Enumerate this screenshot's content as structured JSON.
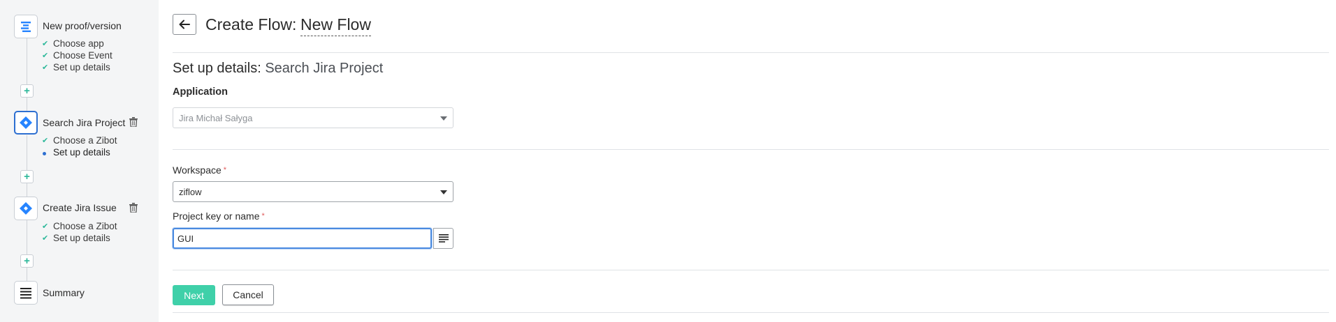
{
  "sidebar": {
    "steps": [
      {
        "title": "New proof/version",
        "icon": "trigger-lines-icon",
        "substeps": [
          {
            "label": "Choose app",
            "status": "done"
          },
          {
            "label": "Choose Event",
            "status": "done"
          },
          {
            "label": "Set up details",
            "status": "done"
          }
        ]
      },
      {
        "title": "Search Jira Project",
        "icon": "jira-icon",
        "active": true,
        "substeps": [
          {
            "label": "Choose a Zibot",
            "status": "done"
          },
          {
            "label": "Set up details",
            "status": "current"
          }
        ]
      },
      {
        "title": "Create Jira Issue",
        "icon": "jira-icon",
        "substeps": [
          {
            "label": "Choose a Zibot",
            "status": "done"
          },
          {
            "label": "Set up details",
            "status": "done"
          }
        ]
      },
      {
        "title": "Summary",
        "icon": "summary-lines-icon",
        "substeps": []
      }
    ],
    "add_step_symbol": "+"
  },
  "header": {
    "title_prefix": "Create Flow:",
    "flow_name": "New Flow"
  },
  "details": {
    "title_prefix": "Set up details:",
    "step_name": "Search Jira Project",
    "application_label": "Application",
    "application_value": "Jira Michał Sałyga",
    "workspace_label": "Workspace",
    "workspace_value": "ziflow",
    "project_label": "Project key or name",
    "project_value": "GUI",
    "required_mark": "*"
  },
  "actions": {
    "next_label": "Next",
    "cancel_label": "Cancel"
  },
  "colors": {
    "accent_green": "#3fd0a9",
    "check_green": "#2db89a",
    "active_blue": "#2d6fd1",
    "jira_blue": "#2684ff",
    "required_red": "#e05a5a"
  }
}
